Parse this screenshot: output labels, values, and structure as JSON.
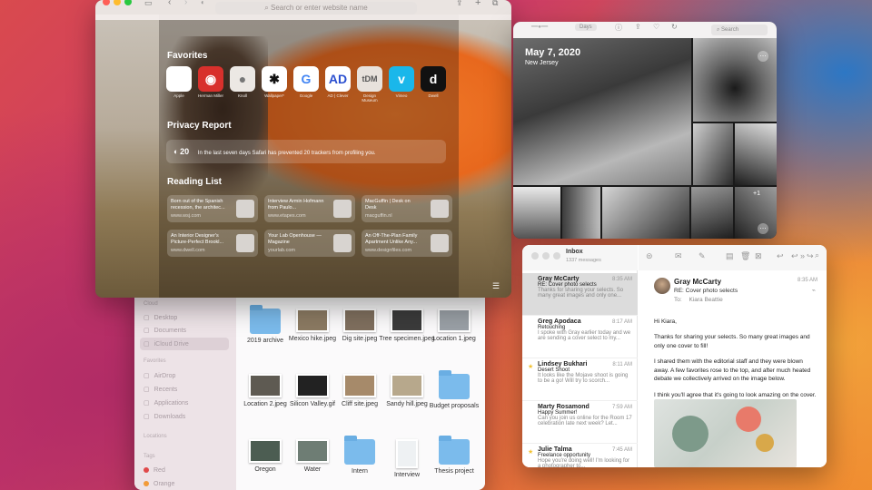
{
  "safari": {
    "url_placeholder": "Search or enter website name",
    "favorites_title": "Favorites",
    "favorites": [
      {
        "label": "Apple",
        "icon": "apple-icon",
        "glyph": "",
        "bg": "#ffffff",
        "fg": "#222222"
      },
      {
        "label": "Herman Miller",
        "icon": "herman-miller-icon",
        "glyph": "◉",
        "bg": "#d8302c",
        "fg": "#ffffff"
      },
      {
        "label": "Knoll",
        "icon": "knoll-icon",
        "glyph": "●",
        "bg": "#ece8e4",
        "fg": "#777777"
      },
      {
        "label": "Wallpaper*",
        "icon": "asterisk-icon",
        "glyph": "✱",
        "bg": "#ffffff",
        "fg": "#111111"
      },
      {
        "label": "Google",
        "icon": "google-icon",
        "glyph": "G",
        "bg": "#ffffff",
        "fg": "#4285f4"
      },
      {
        "label": "AD | Clever",
        "icon": "ad-icon",
        "glyph": "AD",
        "bg": "#ffffff",
        "fg": "#2a4fd0"
      },
      {
        "label": "Design Museum",
        "icon": "tdm-icon",
        "glyph": "tDM",
        "bg": "#e8e2dc",
        "fg": "#555555"
      },
      {
        "label": "Vimeo",
        "icon": "vimeo-icon",
        "glyph": "v",
        "bg": "#1ab7ea",
        "fg": "#ffffff"
      },
      {
        "label": "Dwell",
        "icon": "dwell-icon",
        "glyph": "d",
        "bg": "#111111",
        "fg": "#ffffff"
      }
    ],
    "privacy_title": "Privacy Report",
    "privacy_count": "20",
    "privacy_text": "In the last seven days Safari has prevented 20 trackers from profiling you.",
    "reading_title": "Reading List",
    "reading": [
      {
        "title": "Born out of the Spanish recession, the architec...",
        "url": "www.wsj.com"
      },
      {
        "title": "Interview Armin Hofmann from Paulo...",
        "url": "www.etapes.com"
      },
      {
        "title": "MacGuffin | Desk on Desk",
        "url": "macguffin.nl"
      },
      {
        "title": "An Interior Designer's Picture-Perfect Brookl...",
        "url": "www.dwell.com"
      },
      {
        "title": "Your Lab Openhouse — Magazine",
        "url": "yourlab.com"
      },
      {
        "title": "An Off-The-Plan Family Apartment Unlike Any...",
        "url": "www.designfiles.com"
      }
    ]
  },
  "photos": {
    "segment": "Days",
    "search_placeholder": "Search",
    "date": "May 7, 2020",
    "location": "New Jersey",
    "overflow_count": "+1"
  },
  "finder": {
    "sidebar": [
      {
        "label": "Cloud",
        "kind": "hdr"
      },
      {
        "label": "Desktop",
        "kind": "item"
      },
      {
        "label": "Documents",
        "kind": "item"
      },
      {
        "label": "iCloud Drive",
        "kind": "sel"
      },
      {
        "label": "Favorites",
        "kind": "hdr"
      },
      {
        "label": "AirDrop",
        "kind": "item"
      },
      {
        "label": "Recents",
        "kind": "item"
      },
      {
        "label": "Applications",
        "kind": "item"
      },
      {
        "label": "Downloads",
        "kind": "item"
      },
      {
        "label": "Locations",
        "kind": "hdr"
      },
      {
        "label": "Tags",
        "kind": "hdr"
      },
      {
        "label": "Red",
        "kind": "tag",
        "color": "#e0494a"
      },
      {
        "label": "Orange",
        "kind": "tag",
        "color": "#f29b38"
      }
    ],
    "items": [
      {
        "label": "2019 archive",
        "type": "folder"
      },
      {
        "label": "Mexico hike.jpeg",
        "type": "photo",
        "tone": "#8b7a62"
      },
      {
        "label": "Dig site.jpeg",
        "type": "photo",
        "tone": "#7f6f5e"
      },
      {
        "label": "Tree specimen.jpeg",
        "type": "photo",
        "tone": "#3b3b3b"
      },
      {
        "label": "Location 1.jpeg",
        "type": "photo",
        "tone": "#9aa0a6"
      },
      {
        "label": "Location 2.jpeg",
        "type": "photo",
        "tone": "#5e5a52"
      },
      {
        "label": "Silicon Valley.gif",
        "type": "photo",
        "tone": "#222222"
      },
      {
        "label": "Cliff site.jpeg",
        "type": "photo",
        "tone": "#a68a6a"
      },
      {
        "label": "Sandy hill.jpeg",
        "type": "photo",
        "tone": "#b7a88c"
      },
      {
        "label": "Budget proposals",
        "type": "folder"
      },
      {
        "label": "Oregon",
        "type": "photo",
        "tone": "#4c5d52"
      },
      {
        "label": "Water",
        "type": "photo",
        "tone": "#6e7d74"
      },
      {
        "label": "Intern",
        "type": "folder"
      },
      {
        "label": "Interview",
        "type": "doc"
      },
      {
        "label": "Thesis project",
        "type": "folder"
      }
    ]
  },
  "mail": {
    "mailbox": "Inbox",
    "count": "1337 messages",
    "messages": [
      {
        "from": "Gray McCarty",
        "time": "8:35 AM",
        "subject": "RE: Cover photo selects",
        "preview": "Thanks for sharing your selects. So many great images and only one...",
        "star": false,
        "selected": true
      },
      {
        "from": "Greg Apodaca",
        "time": "8:17 AM",
        "subject": "Retouching",
        "preview": "I spoke with Gray earlier today and we are sending a cover select to my...",
        "star": false,
        "selected": false
      },
      {
        "from": "Lindsey Bukhari",
        "time": "8:11 AM",
        "subject": "Desert Shoot",
        "preview": "It looks like the Mojave shoot is going to be a go! Will try to scorch...",
        "star": true,
        "selected": false
      },
      {
        "from": "Marty Rosamond",
        "time": "7:59 AM",
        "subject": "Happy Summer!",
        "preview": "Can you join us online for the Room 17 celebration late next week? Let...",
        "star": false,
        "selected": false
      },
      {
        "from": "Julie Talma",
        "time": "7:45 AM",
        "subject": "Freelance opportunity",
        "preview": "Hope you're doing well! I'm looking for a photographer to...",
        "star": true,
        "selected": false
      }
    ],
    "reader": {
      "from": "Gray McCarty",
      "time": "8:35 AM",
      "subject": "RE: Cover photo selects",
      "to_label": "To:",
      "to": "Kiara Beattie",
      "greeting": "Hi Kiara,",
      "p1": "Thanks for sharing your selects. So many great images and only one cover to fill!",
      "p2": "I shared them with the editorial staff and they were blown away. A few favorites rose to the top, and after much heated debate we collectively arrived on the image below.",
      "p3": "I think you'll agree that it's going to look amazing on the cover. Look for it on newsstands late next week!"
    }
  }
}
